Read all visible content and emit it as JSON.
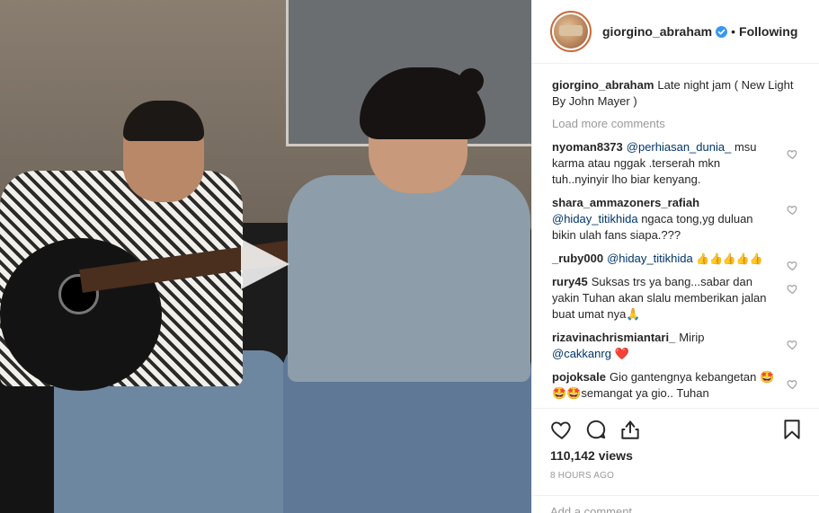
{
  "post": {
    "username": "giorgino_abraham",
    "follow_label": "Following",
    "separator": "•",
    "caption_user": "giorgino_abraham",
    "caption_text": "Late night jam ( New Light By John Mayer )",
    "load_more": "Load more comments"
  },
  "comments": [
    {
      "user": "nyoman8373",
      "mention": "@perhiasan_dunia_",
      "text": " msu karma atau nggak .terserah mkn tuh..nyinyir lho biar kenyang."
    },
    {
      "user": "shara_ammazoners_rafiah",
      "mention": "@hiday_titikhida",
      "text": " ngaca tong,yg duluan bikin ulah fans siapa.???"
    },
    {
      "user": "_ruby000",
      "mention": "@hiday_titikhida",
      "text": " 👍👍👍👍👍"
    },
    {
      "user": "rury45",
      "mention": "",
      "text": "Suksas trs ya bang...sabar dan yakin Tuhan akan slalu memberikan jalan buat umat nya🙏"
    },
    {
      "user": "rizavinachrismiantari_",
      "mention": "",
      "text": "Mirip ",
      "mention2": "@cakkanrg",
      "tail": " ❤️"
    },
    {
      "user": "pojoksale",
      "mention": "",
      "text": "Gio gantengnya kebangetan 🤩🤩🤩semangat ya gio.. Tuhan"
    }
  ],
  "stats": {
    "views": "110,142 views",
    "age": "8 HOURS AGO"
  },
  "add_comment": {
    "placeholder": "Add a comment..."
  },
  "icons": {
    "like": "heart-icon",
    "comment": "comment-bubble-icon",
    "share": "share-icon",
    "save": "bookmark-icon",
    "play": "play-icon",
    "verified": "verified-badge-icon"
  },
  "colors": {
    "text": "#262626",
    "muted": "#999999",
    "mention": "#003569",
    "verified": "#3897f0",
    "border": "#efefef"
  }
}
